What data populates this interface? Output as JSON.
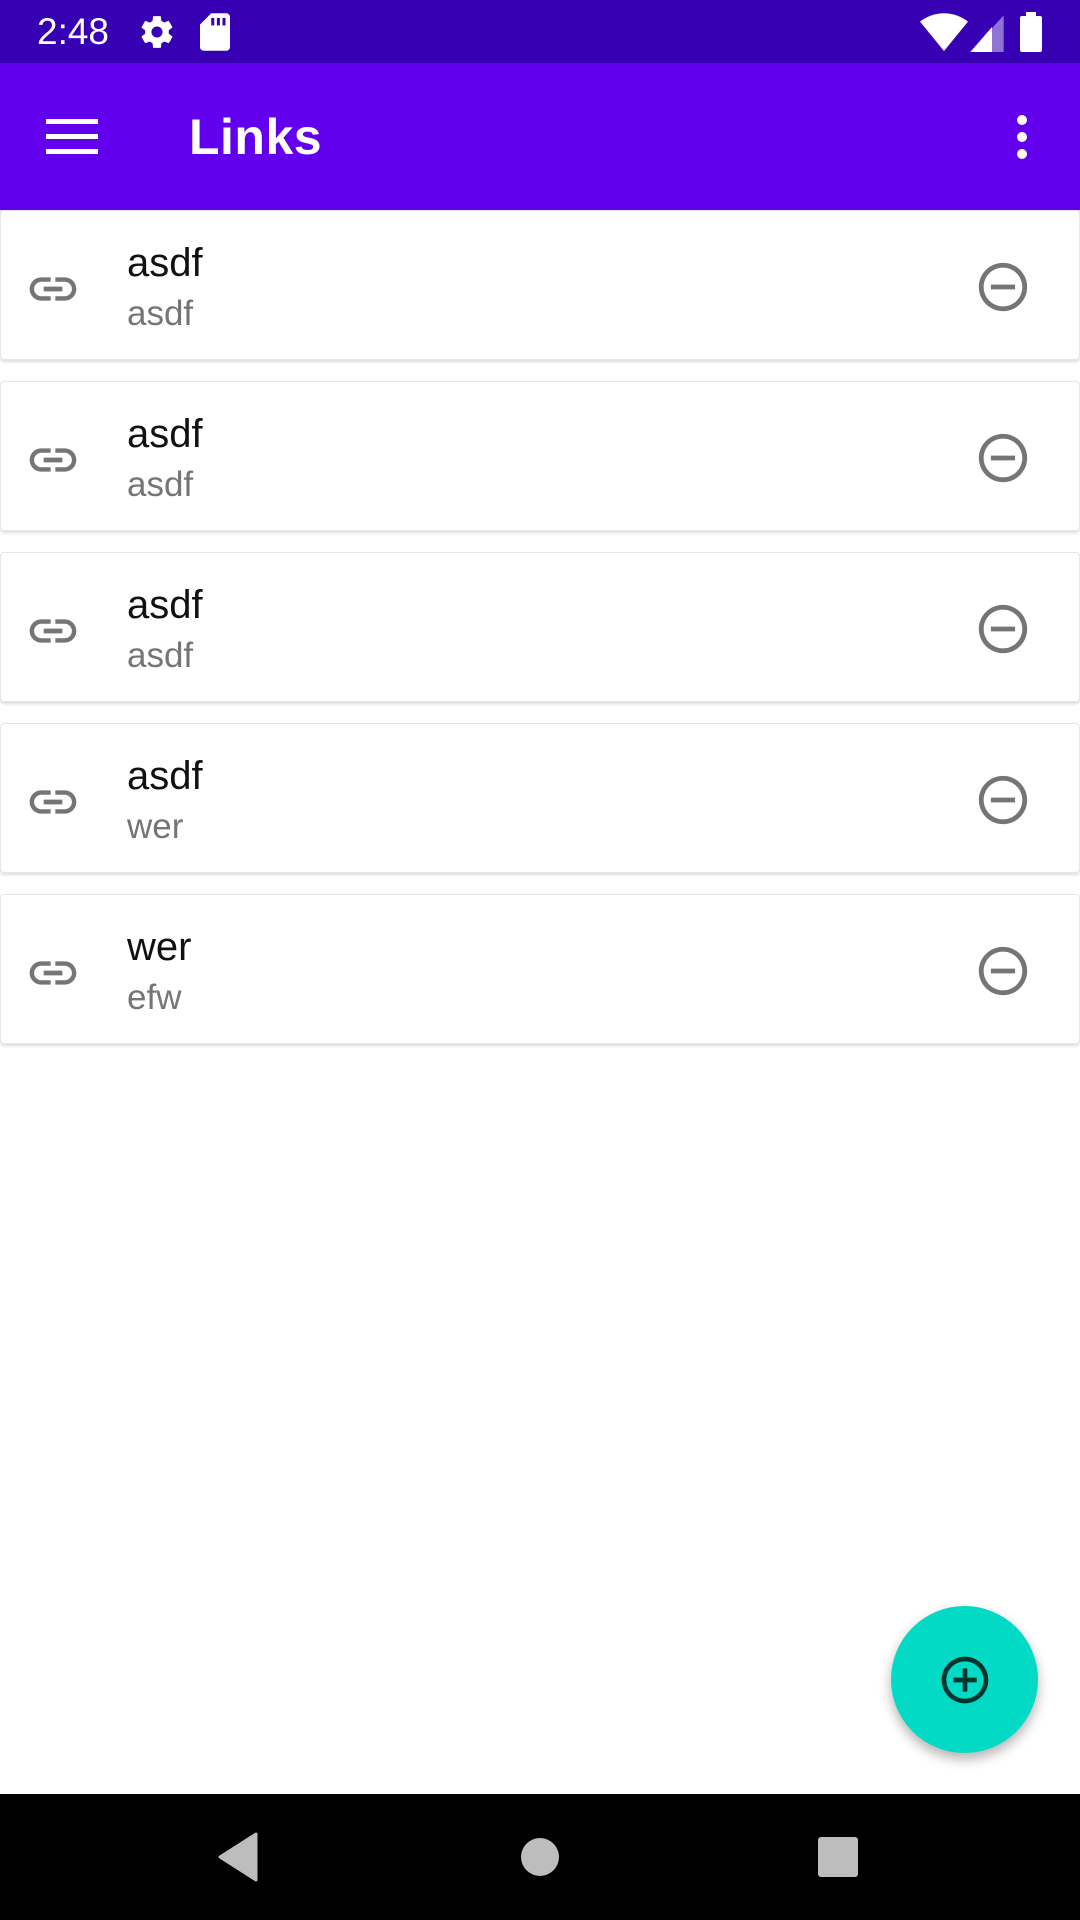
{
  "status_bar": {
    "time": "2:48",
    "icons": [
      "gear-icon",
      "sd-card-icon",
      "wifi-icon",
      "cell-signal-icon",
      "battery-icon"
    ]
  },
  "app_bar": {
    "title": "Links",
    "menu_icon": "hamburger-menu-icon",
    "overflow_icon": "more-vert-icon",
    "color": "#6200ee",
    "status_color": "#3700b3"
  },
  "links": [
    {
      "title": "asdf",
      "subtitle": "asdf",
      "icon": "link-icon",
      "action_icon": "remove-circle-icon"
    },
    {
      "title": "asdf",
      "subtitle": "asdf",
      "icon": "link-icon",
      "action_icon": "remove-circle-icon"
    },
    {
      "title": "asdf",
      "subtitle": "asdf",
      "icon": "link-icon",
      "action_icon": "remove-circle-icon"
    },
    {
      "title": "asdf",
      "subtitle": "wer",
      "icon": "link-icon",
      "action_icon": "remove-circle-icon"
    },
    {
      "title": "wer",
      "subtitle": "efw",
      "icon": "link-icon",
      "action_icon": "remove-circle-icon"
    }
  ],
  "fab": {
    "icon": "add-circle-icon",
    "color": "#03dac5"
  },
  "nav_bar": {
    "icons": [
      "back-icon",
      "home-icon",
      "recents-icon"
    ]
  }
}
